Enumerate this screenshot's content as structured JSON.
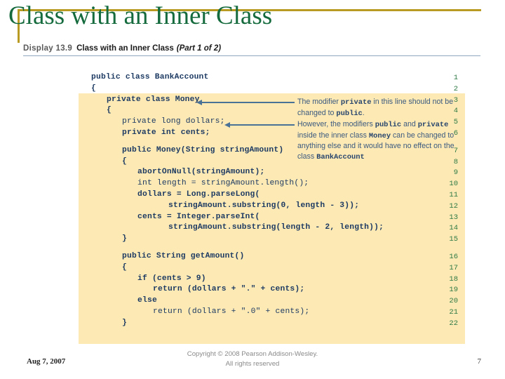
{
  "slide": {
    "title": "Class with an Inner Class",
    "accent_color": "#b99a22",
    "title_color": "#156b3d"
  },
  "caption": {
    "display_number": "Display 13.9",
    "display_title": "Class with an Inner Class",
    "part": "(Part 1 of 2)"
  },
  "code": {
    "panel_color": "#fce9b4",
    "line_number_color": "#2f7a46",
    "text_color": "#1d3a63",
    "lines": [
      {
        "n": "1",
        "text": "public class BankAccount",
        "indent": 0,
        "bold": true,
        "shaded": false
      },
      {
        "n": "2",
        "text": "{",
        "indent": 0,
        "bold": true,
        "shaded": false
      },
      {
        "n": "3",
        "text": "private class Money",
        "indent": 1,
        "bold": true,
        "shaded": true
      },
      {
        "n": "4",
        "text": "{",
        "indent": 1,
        "bold": true,
        "shaded": true
      },
      {
        "n": "5",
        "text": "private long dollars;",
        "indent": 2,
        "bold": false,
        "shaded": true
      },
      {
        "n": "6",
        "text": "private int cents;",
        "indent": 2,
        "bold": true,
        "shaded": true
      },
      {
        "n": "7",
        "text": "public Money(String stringAmount)",
        "indent": 2,
        "bold": true,
        "shaded": true
      },
      {
        "n": "8",
        "text": "{",
        "indent": 2,
        "bold": true,
        "shaded": true
      },
      {
        "n": "9",
        "text": "abortOnNull(stringAmount);",
        "indent": 3,
        "bold": true,
        "shaded": true
      },
      {
        "n": "10",
        "text": "int length = stringAmount.length();",
        "indent": 3,
        "bold": false,
        "shaded": true
      },
      {
        "n": "11",
        "text": "dollars = Long.parseLong(",
        "indent": 3,
        "bold": true,
        "shaded": true
      },
      {
        "n": "12",
        "text": "stringAmount.substring(0, length - 3));",
        "indent": 5,
        "bold": true,
        "shaded": true
      },
      {
        "n": "13",
        "text": "cents = Integer.parseInt(",
        "indent": 3,
        "bold": true,
        "shaded": true
      },
      {
        "n": "14",
        "text": "stringAmount.substring(length - 2, length));",
        "indent": 5,
        "bold": true,
        "shaded": true
      },
      {
        "n": "15",
        "text": "}",
        "indent": 2,
        "bold": true,
        "shaded": true
      },
      {
        "n": "16",
        "text": "public String getAmount()",
        "indent": 2,
        "bold": true,
        "shaded": true
      },
      {
        "n": "17",
        "text": "{",
        "indent": 2,
        "bold": true,
        "shaded": true
      },
      {
        "n": "18",
        "text": "if (cents > 9)",
        "indent": 3,
        "bold": true,
        "shaded": true
      },
      {
        "n": "19",
        "text": "return (dollars + \".\" + cents);",
        "indent": 4,
        "bold": true,
        "shaded": true
      },
      {
        "n": "20",
        "text": "else",
        "indent": 3,
        "bold": true,
        "shaded": true
      },
      {
        "n": "21",
        "text": "return (dollars + \".0\" + cents);",
        "indent": 4,
        "bold": false,
        "shaded": true
      },
      {
        "n": "22",
        "text": "}",
        "indent": 2,
        "bold": true,
        "shaded": true
      }
    ]
  },
  "annotations": {
    "note1": {
      "target_line": "3",
      "part1": "The modifier ",
      "code1": "private",
      "part2": " in this line should not be changed to ",
      "code2": "public",
      "part3": "."
    },
    "note2": {
      "target_line": "5",
      "part1": "However, the modifiers ",
      "code1": "public",
      "part2": " and ",
      "code2": "private",
      "part3": " inside the inner class ",
      "code3": "Money",
      "part4": " can be changed to anything else and it would have no effect on the class ",
      "code4": "BankAccount"
    },
    "leader_color": "#4a7296"
  },
  "footer": {
    "date": "Aug 7, 2007",
    "copyright_line1": "Copyright © 2008 Pearson Addison-Wesley.",
    "copyright_line2": "All rights reserved",
    "page_number": "7"
  }
}
